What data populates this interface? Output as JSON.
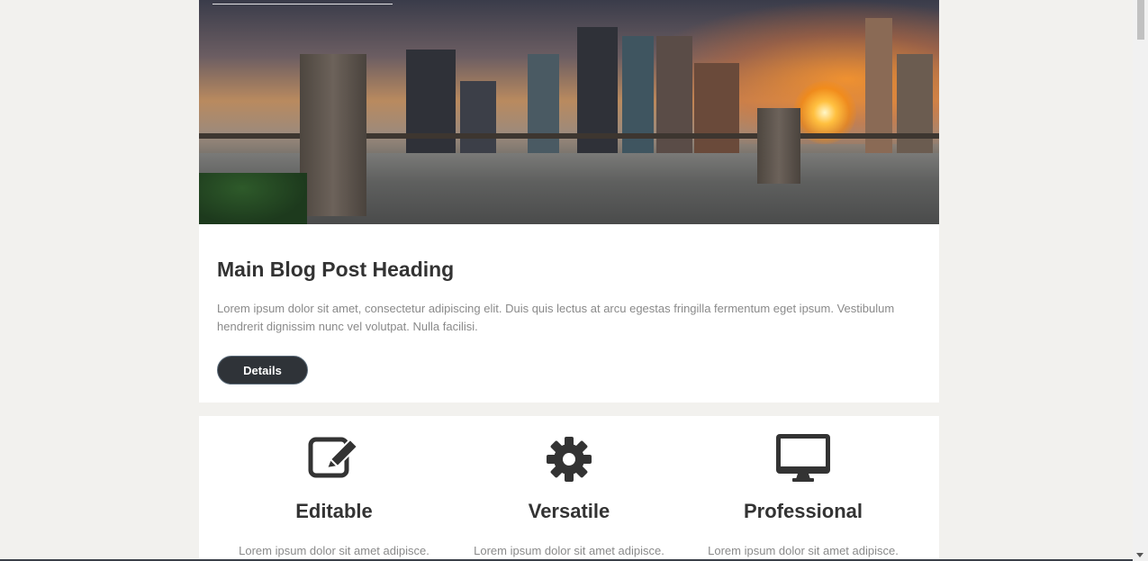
{
  "post": {
    "heading": "Main Blog Post Heading",
    "body": "Lorem ipsum dolor sit amet, consectetur adipiscing elit. Duis quis lectus at arcu egestas fringilla fermentum eget ipsum. Vestibulum hendrerit dignissim nunc vel volutpat. Nulla facilisi.",
    "button_label": "Details"
  },
  "features": [
    {
      "icon": "edit-icon",
      "title": "Editable",
      "text": "Lorem ipsum dolor sit amet adipisce."
    },
    {
      "icon": "gear-icon",
      "title": "Versatile",
      "text": "Lorem ipsum dolor sit amet adipisce."
    },
    {
      "icon": "monitor-icon",
      "title": "Professional",
      "text": "Lorem ipsum dolor sit amet adipisce."
    }
  ],
  "colors": {
    "page_bg": "#f2f1ee",
    "button_bg": "#2f3338",
    "heading": "#333333",
    "body_text": "#8a8a8a"
  }
}
